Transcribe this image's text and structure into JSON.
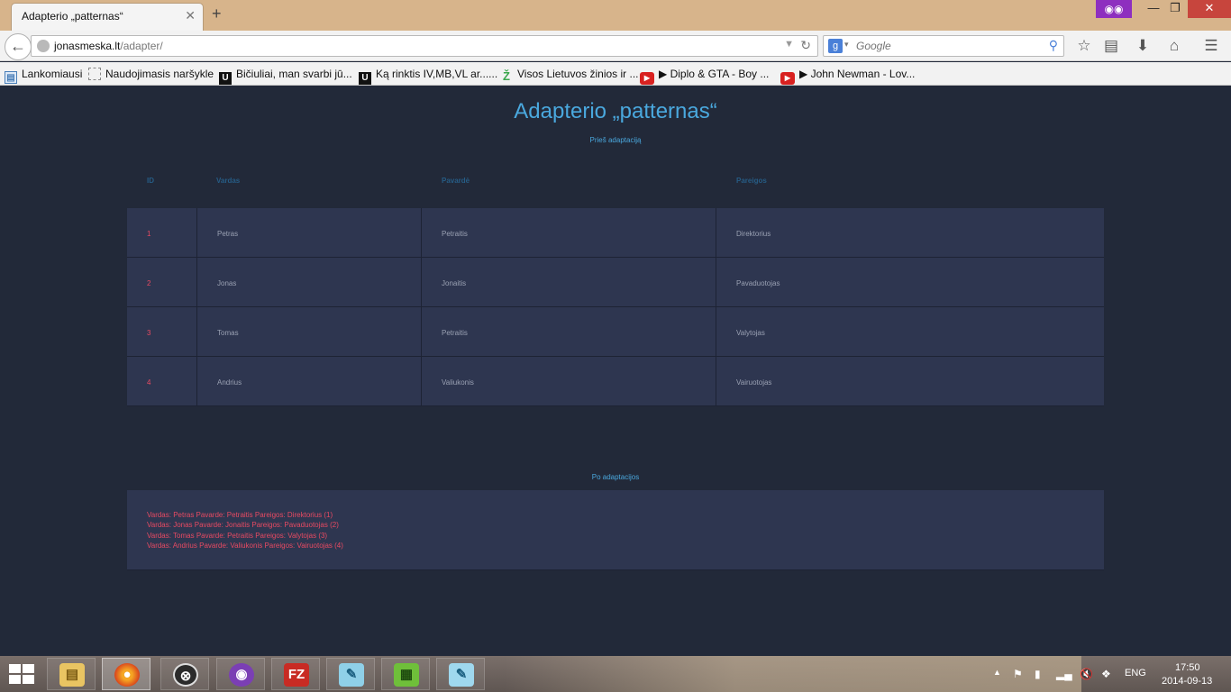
{
  "browser": {
    "tab_title": "Adapterio „patternas“",
    "close_tab": "✕",
    "new_tab": "+",
    "url_host": "jonasmeska.lt",
    "url_path": "/adapter/",
    "search_placeholder": "Google",
    "search_engine_letter": "g"
  },
  "bookmarks": [
    {
      "label": "Lankomiausi",
      "icon": "bookmark-folder-icon"
    },
    {
      "label": "Naudojimasis naršykle",
      "icon": "blank-page-icon"
    },
    {
      "label": "Bičiuliai, man svarbi jū...",
      "icon": "u-logo-icon"
    },
    {
      "label": "Ką rinktis IV,MB,VL ar......",
      "icon": "u-logo-icon"
    },
    {
      "label": "Visos Lietuvos žinios ir ...",
      "icon": "z-logo-icon"
    },
    {
      "label": "▶ Diplo & GTA - Boy ...",
      "icon": "youtube-icon"
    },
    {
      "label": "▶ John Newman - Lov...",
      "icon": "youtube-icon"
    }
  ],
  "page": {
    "title": "Adapterio „patternas“",
    "before_label": "Prieš adaptaciją",
    "columns": [
      "ID",
      "Vardas",
      "Pavardė",
      "Pareigos"
    ],
    "rows": [
      {
        "id": "1",
        "vardas": "Petras",
        "pavarde": "Petraitis",
        "pareigos": "Direktorius"
      },
      {
        "id": "2",
        "vardas": "Jonas",
        "pavarde": "Jonaitis",
        "pareigos": "Pavaduotojas"
      },
      {
        "id": "3",
        "vardas": "Tomas",
        "pavarde": "Petraitis",
        "pareigos": "Valytojas"
      },
      {
        "id": "4",
        "vardas": "Andrius",
        "pavarde": "Valiukonis",
        "pareigos": "Vairuotojas"
      }
    ],
    "after_label": "Po adaptacijos",
    "output_lines": [
      "Vardas: Petras Pavarde: Petraitis Pareigos: Direktorius (1)",
      "Vardas: Jonas Pavarde: Jonaitis Pareigos: Pavaduotojas (2)",
      "Vardas: Tomas Pavarde: Petraitis Pareigos: Valytojas (3)",
      "Vardas: Andrius Pavarde: Valiukonis Pareigos: Vairuotojas (4)"
    ]
  },
  "taskbar": {
    "apps": [
      "file-explorer-icon",
      "firefox-icon",
      "steam-icon",
      "cat-app-icon",
      "filezilla-icon",
      "notepad-icon",
      "spreadsheet-icon",
      "notepad2-icon"
    ],
    "filezilla_letter": "FZ",
    "language": "ENG",
    "time": "17:50",
    "date": "2014-09-13"
  },
  "colors": {
    "page_bg": "#222939",
    "row_bg": "#2e3650",
    "accent_blue": "#4aa8de",
    "accent_red": "#e84a62"
  }
}
